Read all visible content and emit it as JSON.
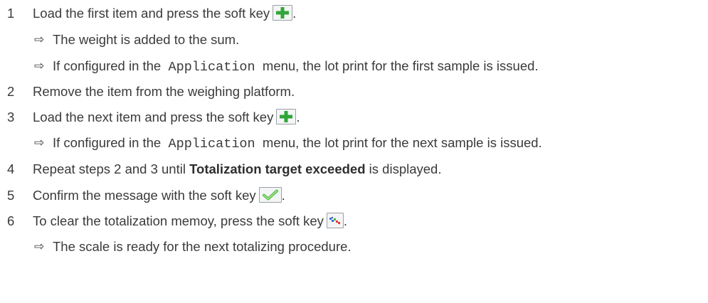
{
  "steps": [
    {
      "number": "1",
      "text_before": "Load the first item and press the soft key",
      "key_icon": "plus-icon",
      "text_after": ".",
      "results": [
        {
          "arrow": "⇨",
          "text": "The weight is added to the sum."
        },
        {
          "arrow": "⇨",
          "text_before": "If configured in the",
          "code": "Application",
          "text_after": "menu, the lot print for the first sample is issued."
        }
      ]
    },
    {
      "number": "2",
      "text": "Remove the item from the weighing platform."
    },
    {
      "number": "3",
      "text_before": "Load the next item and press the soft key",
      "key_icon": "plus-icon",
      "text_after": ".",
      "results": [
        {
          "arrow": "⇨",
          "text_before": "If configured in the",
          "code": "Application",
          "text_after": "menu, the lot print for the next sample is issued."
        }
      ]
    },
    {
      "number": "4",
      "text_before": "Repeat steps 2 and 3 until",
      "bold": "Totalization target exceeded",
      "text_after": "is displayed."
    },
    {
      "number": "5",
      "text_before": "Confirm the message with the soft key",
      "key_icon": "checkmark-icon",
      "text_after": "."
    },
    {
      "number": "6",
      "text_before": "To clear the totalization memoy, press the soft key",
      "key_icon": "clear-memory-icon",
      "text_after": ".",
      "results": [
        {
          "arrow": "⇨",
          "text": "The scale is ready for the next totalizing procedure."
        }
      ]
    }
  ],
  "colors": {
    "text": "#3a3a3a",
    "plus_icon": "#2fa63a",
    "check_icon": "#5cc24a",
    "key_border": "#9aa0a6"
  }
}
